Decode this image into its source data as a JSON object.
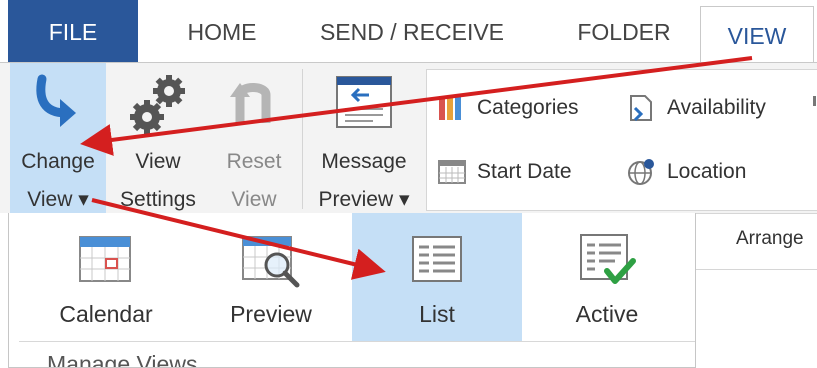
{
  "tabs": {
    "file": "FILE",
    "home": "HOME",
    "send_receive": "SEND / RECEIVE",
    "folder": "FOLDER",
    "view": "VIEW"
  },
  "ribbon": {
    "change_view": {
      "line1": "Change",
      "line2": "View ▾"
    },
    "view_settings": {
      "line1": "View",
      "line2": "Settings"
    },
    "reset_view": {
      "line1": "Reset",
      "line2": "View"
    },
    "message_preview": {
      "line1": "Message",
      "line2": "Preview ▾"
    },
    "arrangement": {
      "categories": "Categories",
      "availability": "Availability",
      "start_date": "Start Date",
      "location": "Location",
      "group_label": "Arrange"
    }
  },
  "change_view_menu": {
    "items": [
      "Calendar",
      "Preview",
      "List",
      "Active"
    ],
    "selected": "List",
    "section_label_partial": "Manage Views"
  },
  "colors": {
    "file_tab": "#2a579a",
    "selection": "#c5dff6",
    "annotation_arrow": "#d41f1f"
  }
}
